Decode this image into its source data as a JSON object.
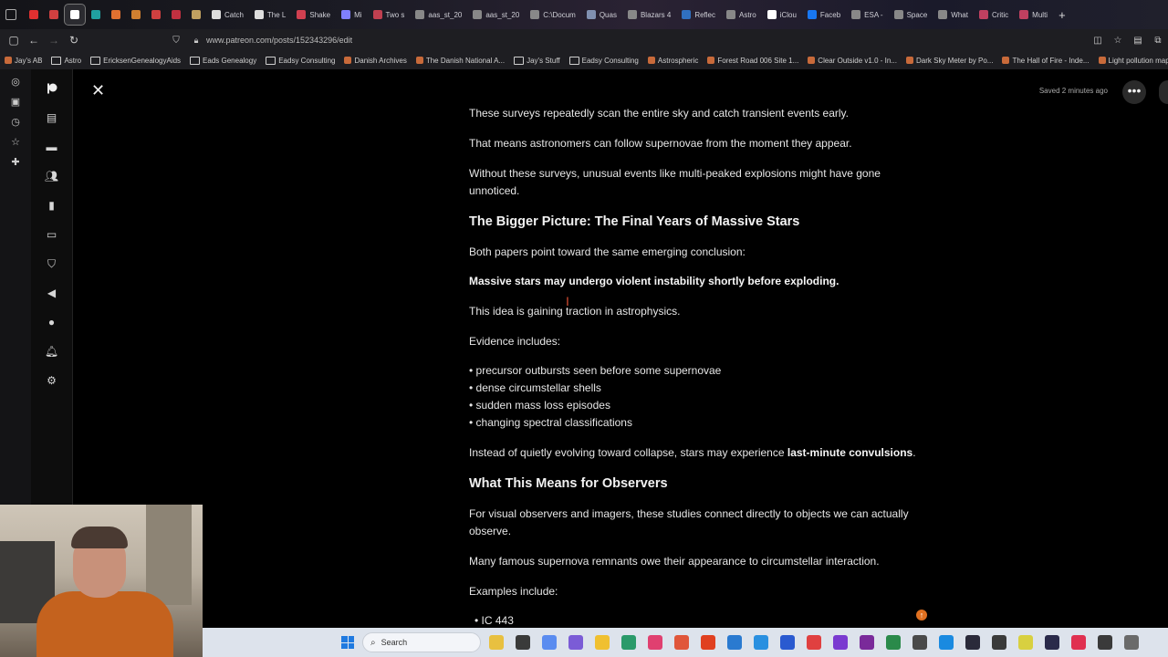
{
  "browser": {
    "tabs": [
      {
        "label": "",
        "color": "#e03030"
      },
      {
        "label": "",
        "color": "#d04040"
      },
      {
        "label": "",
        "color": "#ffffff",
        "active": true
      },
      {
        "label": "",
        "color": "#20a0a0"
      },
      {
        "label": "",
        "color": "#e07030"
      },
      {
        "label": "",
        "color": "#d08030"
      },
      {
        "label": "",
        "color": "#d04040"
      },
      {
        "label": "",
        "color": "#c03040"
      },
      {
        "label": "",
        "color": "#c0a060"
      },
      {
        "label": "Catch",
        "color": "#dddddd"
      },
      {
        "label": "The L",
        "color": "#dddddd"
      },
      {
        "label": "Shake",
        "color": "#d04050"
      },
      {
        "label": "Mi",
        "color": "#8080ff"
      },
      {
        "label": "Two s",
        "color": "#c04050"
      },
      {
        "label": "aas_st_20",
        "color": "#888888"
      },
      {
        "label": "aas_st_20",
        "color": "#888888"
      },
      {
        "label": "C:\\Docum",
        "color": "#888888"
      },
      {
        "label": "Quas",
        "color": "#8090b0"
      },
      {
        "label": "Blazars 4",
        "color": "#888888"
      },
      {
        "label": "Reflec",
        "color": "#3070c0"
      },
      {
        "label": "Astro",
        "color": "#888888"
      },
      {
        "label": "iClou",
        "color": "#ffffff"
      },
      {
        "label": "Faceb",
        "color": "#1877f2"
      },
      {
        "label": "ESA -",
        "color": "#888888"
      },
      {
        "label": "Space",
        "color": "#888888"
      },
      {
        "label": "What",
        "color": "#888888"
      },
      {
        "label": "Critic",
        "color": "#c04060"
      },
      {
        "label": "Multi",
        "color": "#c04060"
      }
    ],
    "url": "www.patreon.com/posts/152343296/edit",
    "bookmarks": [
      {
        "label": "Jay's AB",
        "type": "site"
      },
      {
        "label": "Astro",
        "type": "folder"
      },
      {
        "label": "EricksenGenealogyAids",
        "type": "folder"
      },
      {
        "label": "Eads Genealogy",
        "type": "folder"
      },
      {
        "label": "Eadsy Consulting",
        "type": "folder"
      },
      {
        "label": "Danish Archives",
        "type": "site"
      },
      {
        "label": "The Danish National A...",
        "type": "site"
      },
      {
        "label": "Jay's Stuff",
        "type": "folder"
      },
      {
        "label": "Eadsy Consulting",
        "type": "folder"
      },
      {
        "label": "Astrospheric",
        "type": "site"
      },
      {
        "label": "Forest Road 006 Site 1...",
        "type": "site"
      },
      {
        "label": "Clear Outside v1.0 - In...",
        "type": "site"
      },
      {
        "label": "Dark Sky Meter by Po...",
        "type": "site"
      },
      {
        "label": "The Hall of Fire - Inde...",
        "type": "site"
      },
      {
        "label": "Light pollution map",
        "type": "site"
      }
    ]
  },
  "editor": {
    "saved_status": "Saved 2 minutes ago",
    "more_label": "•••",
    "blocks": [
      {
        "type": "p",
        "text": "These surveys repeatedly scan the entire sky and catch transient events early."
      },
      {
        "type": "p",
        "text": "That means astronomers can follow supernovae from the moment they appear."
      },
      {
        "type": "p",
        "text": "Without these surveys, unusual events like multi-peaked explosions might have gone unnoticed."
      },
      {
        "type": "h2",
        "text": "The Bigger Picture: The Final Years of Massive Stars"
      },
      {
        "type": "p",
        "text": "Both papers point toward the same emerging conclusion:"
      },
      {
        "type": "pb",
        "text": "Massive stars may undergo violent instability shortly before exploding."
      },
      {
        "type": "p",
        "text": "This idea is gaining traction in astrophysics."
      },
      {
        "type": "p",
        "text": "Evidence includes:"
      },
      {
        "type": "list",
        "items": [
          "• precursor outbursts seen before some supernovae",
          "• dense circumstellar shells",
          "• sudden mass loss episodes",
          "• changing spectral classifications"
        ]
      },
      {
        "type": "pmix",
        "text": "Instead of quietly evolving toward collapse, stars may experience ",
        "bold": "last-minute convulsions",
        "tail": "."
      },
      {
        "type": "h2",
        "text": "What This Means for Observers"
      },
      {
        "type": "p",
        "text": "For visual observers and imagers, these studies connect directly to objects we can actually observe."
      },
      {
        "type": "p",
        "text": "Many famous supernova remnants owe their appearance to circumstellar interaction."
      },
      {
        "type": "p",
        "text": "Examples include:"
      },
      {
        "type": "list",
        "items": [
          "• IC 443"
        ]
      }
    ]
  },
  "taskbar": {
    "search_label": "Search",
    "app_colors": [
      "#e8c040",
      "#3a3a3a",
      "#5a8cf0",
      "#7b5cd6",
      "#f0c030",
      "#2a9a6a",
      "#e04070",
      "#e0563a",
      "#e04020",
      "#2a7ad0",
      "#2a90e0",
      "#2a5ad0",
      "#e04040",
      "#7a3ad0",
      "#7a2a9a",
      "#2a8a4a",
      "#4a4a4a",
      "#1a8ae0",
      "#2a2a3a",
      "#3a3a3a",
      "#d8d040",
      "#2a2a4a",
      "#e03050",
      "#3a3a3a",
      "#6a6a6a"
    ]
  }
}
